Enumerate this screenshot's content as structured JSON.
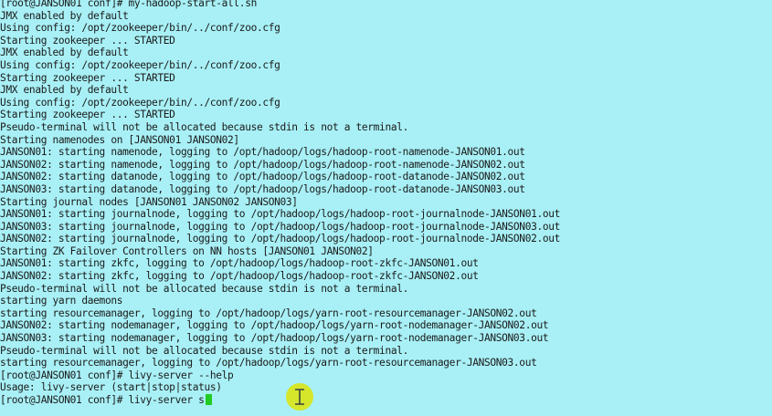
{
  "terminal": {
    "background": "#a8f0f6",
    "cursor_color": "#22cc22",
    "pointer_highlight": "#d9e61a",
    "lines": [
      "[root@JANSON01 conf]# my-hadoop-start-all.sh",
      "JMX enabled by default",
      "Using config: /opt/zookeeper/bin/../conf/zoo.cfg",
      "Starting zookeeper ... STARTED",
      "JMX enabled by default",
      "Using config: /opt/zookeeper/bin/../conf/zoo.cfg",
      "Starting zookeeper ... STARTED",
      "JMX enabled by default",
      "Using config: /opt/zookeeper/bin/../conf/zoo.cfg",
      "Starting zookeeper ... STARTED",
      "Pseudo-terminal will not be allocated because stdin is not a terminal.",
      "Starting namenodes on [JANSON01 JANSON02]",
      "JANSON01: starting namenode, logging to /opt/hadoop/logs/hadoop-root-namenode-JANSON01.out",
      "JANSON02: starting namenode, logging to /opt/hadoop/logs/hadoop-root-namenode-JANSON02.out",
      "JANSON02: starting datanode, logging to /opt/hadoop/logs/hadoop-root-datanode-JANSON02.out",
      "JANSON03: starting datanode, logging to /opt/hadoop/logs/hadoop-root-datanode-JANSON03.out",
      "Starting journal nodes [JANSON01 JANSON02 JANSON03]",
      "JANSON01: starting journalnode, logging to /opt/hadoop/logs/hadoop-root-journalnode-JANSON01.out",
      "JANSON03: starting journalnode, logging to /opt/hadoop/logs/hadoop-root-journalnode-JANSON03.out",
      "JANSON02: starting journalnode, logging to /opt/hadoop/logs/hadoop-root-journalnode-JANSON02.out",
      "Starting ZK Failover Controllers on NN hosts [JANSON01 JANSON02]",
      "JANSON01: starting zkfc, logging to /opt/hadoop/logs/hadoop-root-zkfc-JANSON01.out",
      "JANSON02: starting zkfc, logging to /opt/hadoop/logs/hadoop-root-zkfc-JANSON02.out",
      "Pseudo-terminal will not be allocated because stdin is not a terminal.",
      "starting yarn daemons",
      "starting resourcemanager, logging to /opt/hadoop/logs/yarn-root-resourcemanager-JANSON02.out",
      "JANSON02: starting nodemanager, logging to /opt/hadoop/logs/yarn-root-nodemanager-JANSON02.out",
      "JANSON03: starting nodemanager, logging to /opt/hadoop/logs/yarn-root-nodemanager-JANSON03.out",
      "Pseudo-terminal will not be allocated because stdin is not a terminal.",
      "starting resourcemanager, logging to /opt/hadoop/logs/yarn-root-resourcemanager-JANSON03.out",
      "[root@JANSON01 conf]# livy-server --help",
      "Usage: livy-server (start|stop|status)"
    ],
    "prompt_line": "[root@JANSON01 conf]# livy-server s"
  }
}
